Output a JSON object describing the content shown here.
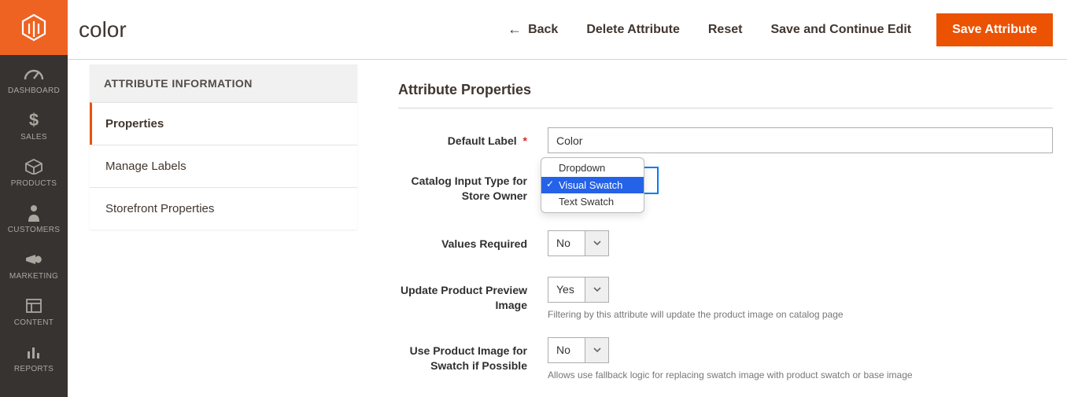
{
  "nav": {
    "items": [
      {
        "label": "DASHBOARD",
        "icon": "dashboard"
      },
      {
        "label": "SALES",
        "icon": "dollar"
      },
      {
        "label": "PRODUCTS",
        "icon": "box"
      },
      {
        "label": "CUSTOMERS",
        "icon": "person"
      },
      {
        "label": "MARKETING",
        "icon": "megaphone"
      },
      {
        "label": "CONTENT",
        "icon": "layout"
      },
      {
        "label": "REPORTS",
        "icon": "bars"
      }
    ]
  },
  "header": {
    "title": "color",
    "back_label": "Back",
    "delete_label": "Delete Attribute",
    "reset_label": "Reset",
    "save_continue_label": "Save and Continue Edit",
    "save_label": "Save Attribute"
  },
  "tabs": {
    "title": "ATTRIBUTE INFORMATION",
    "items": [
      {
        "label": "Properties",
        "active": true
      },
      {
        "label": "Manage Labels",
        "active": false
      },
      {
        "label": "Storefront Properties",
        "active": false
      }
    ]
  },
  "section": {
    "title": "Attribute Properties",
    "default_label": {
      "label": "Default Label",
      "value": "Color",
      "required_mark": "*"
    },
    "input_type": {
      "label": "Catalog Input Type for Store Owner",
      "options": [
        "Dropdown",
        "Visual Swatch",
        "Text Swatch"
      ],
      "selected_index": 1
    },
    "values_required": {
      "label": "Values Required",
      "value": "No"
    },
    "update_preview": {
      "label": "Update Product Preview Image",
      "value": "Yes",
      "note": "Filtering by this attribute will update the product image on catalog page"
    },
    "use_product_image": {
      "label": "Use Product Image for Swatch if Possible",
      "value": "No",
      "note": "Allows use fallback logic for replacing swatch image with product swatch or base image"
    }
  },
  "colors": {
    "accent": "#eb5202",
    "nav_bg": "#373330"
  }
}
